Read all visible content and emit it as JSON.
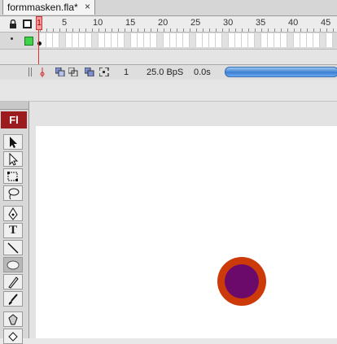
{
  "document_tab": {
    "title": "formmasken.fla*",
    "close_label": "×"
  },
  "timeline": {
    "frame_numbers": [
      "1",
      "5",
      "10",
      "15",
      "20",
      "25",
      "30",
      "35",
      "40",
      "45"
    ],
    "current_frame": "1",
    "footer": {
      "frame": "1",
      "frame_rate": "25.0 BpS",
      "elapsed": "0.0s"
    }
  },
  "tools": {
    "logo": "Fl",
    "text_tool_glyph": "T"
  },
  "stage": {
    "colors": {
      "ring": "#cc3a0a",
      "fill": "#6b0a6b",
      "background": "#ffffff"
    }
  }
}
